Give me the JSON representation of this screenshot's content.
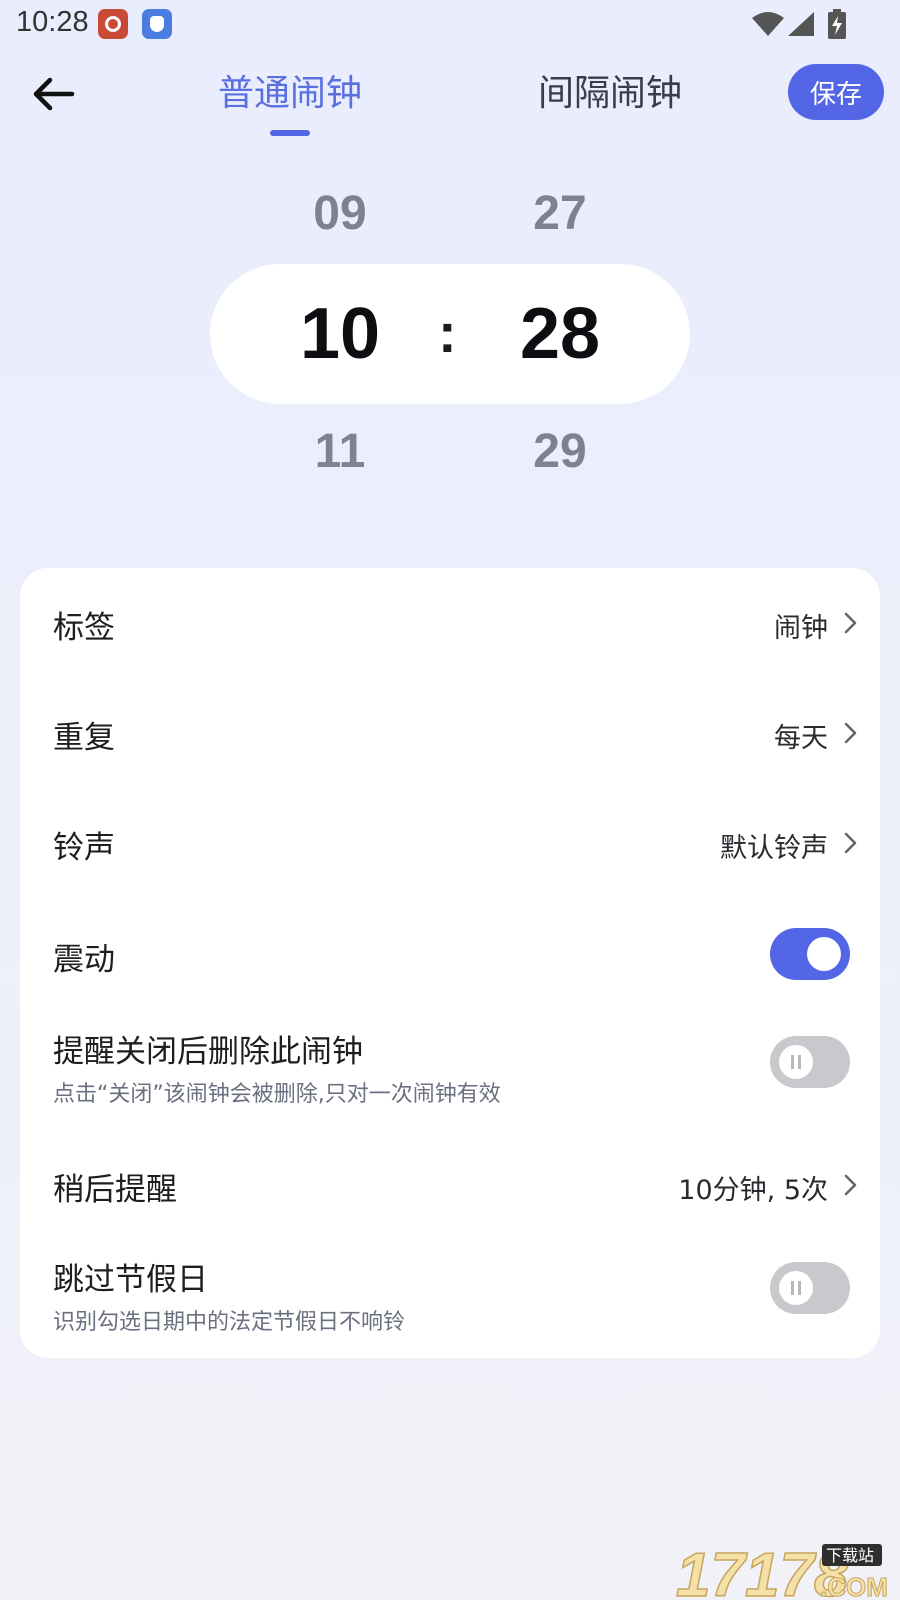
{
  "status_bar": {
    "time": "10:28",
    "icons": [
      "weibo-app-icon",
      "bird-app-icon",
      "wifi-icon",
      "signal-icon",
      "battery-charging-icon"
    ]
  },
  "header": {
    "back_icon": "arrow-left-icon",
    "tabs": [
      {
        "label": "普通闹钟",
        "active": true
      },
      {
        "label": "间隔闹钟",
        "active": false
      }
    ],
    "save_label": "保存"
  },
  "time_picker": {
    "hours": {
      "prev": "09",
      "current": "10",
      "next": "11"
    },
    "minutes": {
      "prev": "27",
      "current": "28",
      "next": "29"
    },
    "separator": ":"
  },
  "settings": {
    "label": {
      "title": "标签",
      "value": "闹钟"
    },
    "repeat": {
      "title": "重复",
      "value": "每天"
    },
    "ringtone": {
      "title": "铃声",
      "value": "默认铃声"
    },
    "vibrate": {
      "title": "震动",
      "enabled": true
    },
    "delete_after": {
      "title": "提醒关闭后删除此闹钟",
      "subtitle": "点击“关闭”该闹钟会被删除,只对一次闹钟有效",
      "enabled": false
    },
    "snooze": {
      "title": "稍后提醒",
      "value": "10分钟, 5次"
    },
    "skip_holidays": {
      "title": "跳过节假日",
      "subtitle": "识别勾选日期中的法定节假日不响铃",
      "enabled": false
    }
  },
  "colors": {
    "accent": "#5366e6",
    "active_tab": "#5a6fe0",
    "background": "#e9edfd",
    "toggle_off": "#c9c9cd"
  },
  "watermark": {
    "text": "17178",
    "suffix": ".COM",
    "badge": "下载站"
  }
}
